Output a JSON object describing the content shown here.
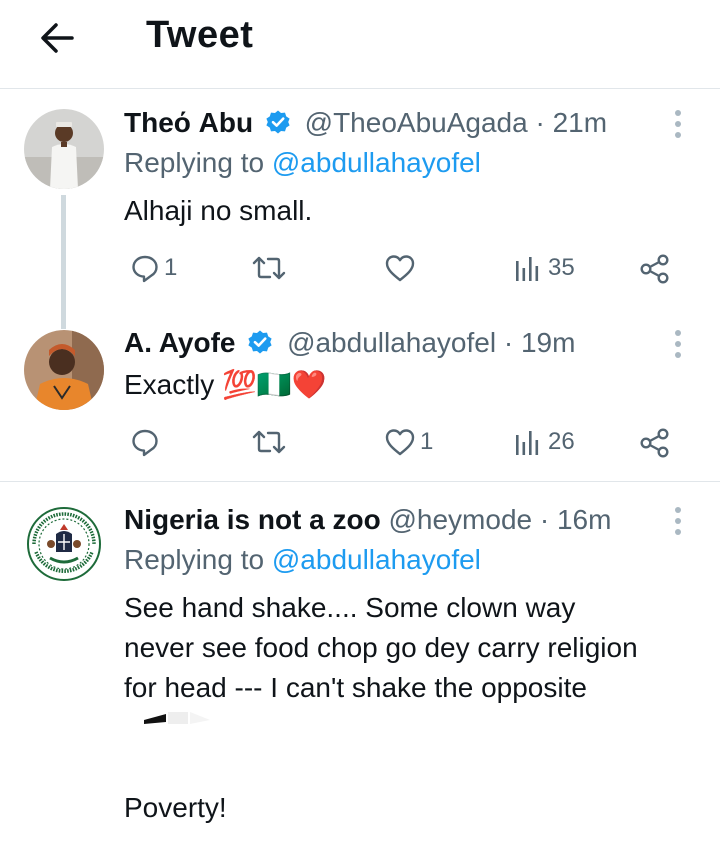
{
  "header": {
    "title": "Tweet",
    "back_icon": "arrow-left-icon"
  },
  "tweets": [
    {
      "display_name": "Theό Abu",
      "handle": "@TheoAbuAgada",
      "separator": "·",
      "time": "21m",
      "replying_prefix": "Replying to",
      "replying_to": "@abdullahayofel",
      "text": "Alhaji no small.",
      "reply_count": "1",
      "retweet_count": "",
      "like_count": "",
      "view_count": "35"
    },
    {
      "display_name": "A. Ayofe",
      "handle": "@abdullahayofel",
      "separator": "·",
      "time": "19m",
      "text": "Exactly 💯🇳🇬❤️",
      "reply_count": "",
      "retweet_count": "",
      "like_count": "1",
      "view_count": "26"
    },
    {
      "display_name": "Nigeria is not a zoo",
      "handle": "@heymode",
      "separator": "·",
      "time": "16m",
      "replying_prefix": "Replying to",
      "replying_to": "@abdullahayofel",
      "text_lines": [
        "See hand shake.... Some clown way",
        "never see food chop go dey carry religion",
        "for head --- I can't shake the opposite",
        "",
        "Poverty!"
      ],
      "avatar_seal_text": "OFFICE OF THE CITIZEN · FEDERAL REPUBLIC OF NIGERIA"
    }
  ],
  "colors": {
    "text": "#0f1419",
    "secondary": "#536471",
    "link": "#1d9bf0",
    "verified": "#1d9bf0",
    "divider": "#e1e6ea",
    "thread_line": "#cfd9de"
  }
}
